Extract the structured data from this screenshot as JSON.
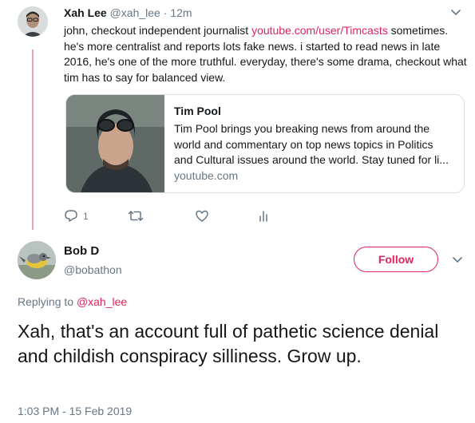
{
  "parent_tweet": {
    "author_name": "Xah Lee",
    "author_handle": "@xah_lee",
    "separator": "·",
    "time": "12m",
    "text_before_link": "john, checkout independent journalist ",
    "link_text": "youtube.com/user/Timcasts",
    "text_after_link": " sometimes. he's more centralist and reports lots fake news. i started to read news in late 2016, he's one of the more truthful. everyday, there's some drama, checkout what tim has to say for balanced view.",
    "card": {
      "title": "Tim Pool",
      "description": "Tim Pool brings you breaking news from around the world and commentary on top news topics in Politics and Cultural issues around the world. Stay tuned for li...",
      "domain": "youtube.com"
    },
    "reply_count": "1",
    "icons": [
      "reply-icon",
      "retweet-icon",
      "like-icon",
      "analytics-icon",
      "chevron-down-icon"
    ]
  },
  "main_tweet": {
    "author_name": "Bob D",
    "author_handle": "@bobathon",
    "follow_label": "Follow",
    "replying_prefix": "Replying to ",
    "replying_to": "@xah_lee",
    "text": "Xah, that's an account full of pathetic science denial and childish conspiracy silliness. Grow up.",
    "timestamp": "1:03 PM - 15 Feb 2019"
  },
  "colors": {
    "accent": "#e0245e",
    "thread_line": "#e1a4b8",
    "secondary_text": "#657786",
    "primary_text": "#14171a",
    "card_border": "#d8dde1"
  }
}
